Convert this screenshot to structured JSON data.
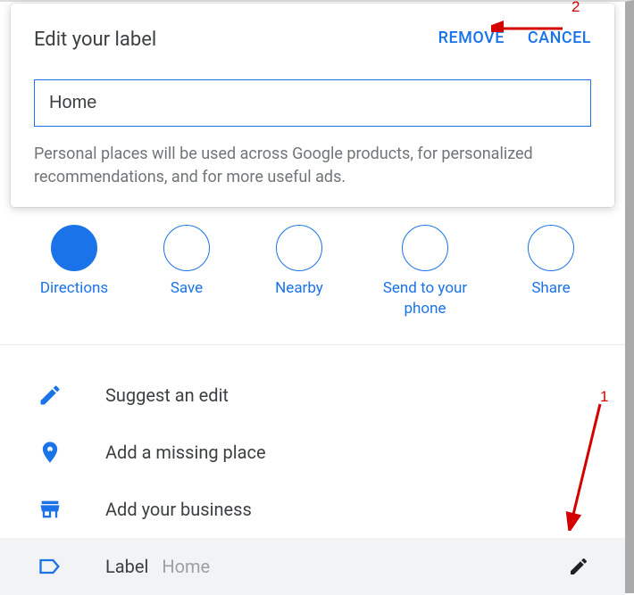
{
  "dialog": {
    "title": "Edit your label",
    "remove_label": "REMOVE",
    "cancel_label": "CANCEL",
    "input_value": "Home",
    "helper_text": "Personal places will be used across Google products, for personalized recommendations, and for more useful ads."
  },
  "actions": {
    "directions": "Directions",
    "save": "Save",
    "nearby": "Nearby",
    "send": "Send to your phone",
    "share": "Share"
  },
  "options": {
    "suggest_edit": "Suggest an edit",
    "add_missing_place": "Add a missing place",
    "add_business": "Add your business",
    "label": "Label",
    "label_value": "Home"
  },
  "annotations": {
    "arrow1_number": "1",
    "arrow2_number": "2"
  }
}
